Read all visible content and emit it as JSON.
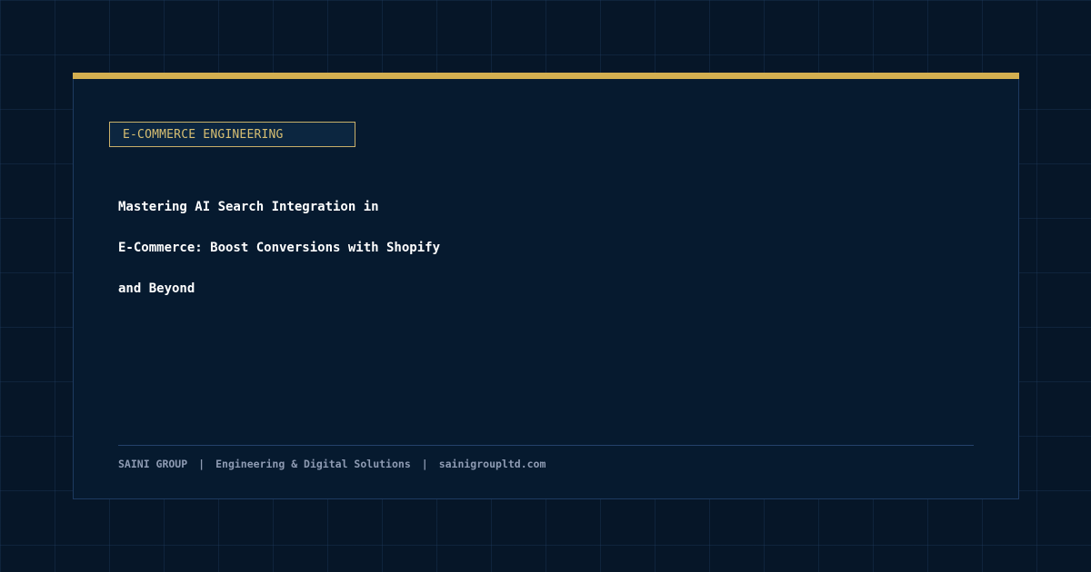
{
  "category": "E-COMMERCE ENGINEERING",
  "title_lines": [
    "Mastering AI Search Integration in",
    "E-Commerce: Boost Conversions with Shopify",
    "and Beyond"
  ],
  "footer": {
    "company": "SAINI GROUP",
    "separator": "|",
    "tagline": "Engineering & Digital Solutions",
    "website": "sainigroupltd.com"
  },
  "colors": {
    "background": "#061628",
    "accent": "#d4af50",
    "badge_text": "#d8bf72",
    "title_text": "#ffffff",
    "footer_text": "#8e9bb3"
  }
}
